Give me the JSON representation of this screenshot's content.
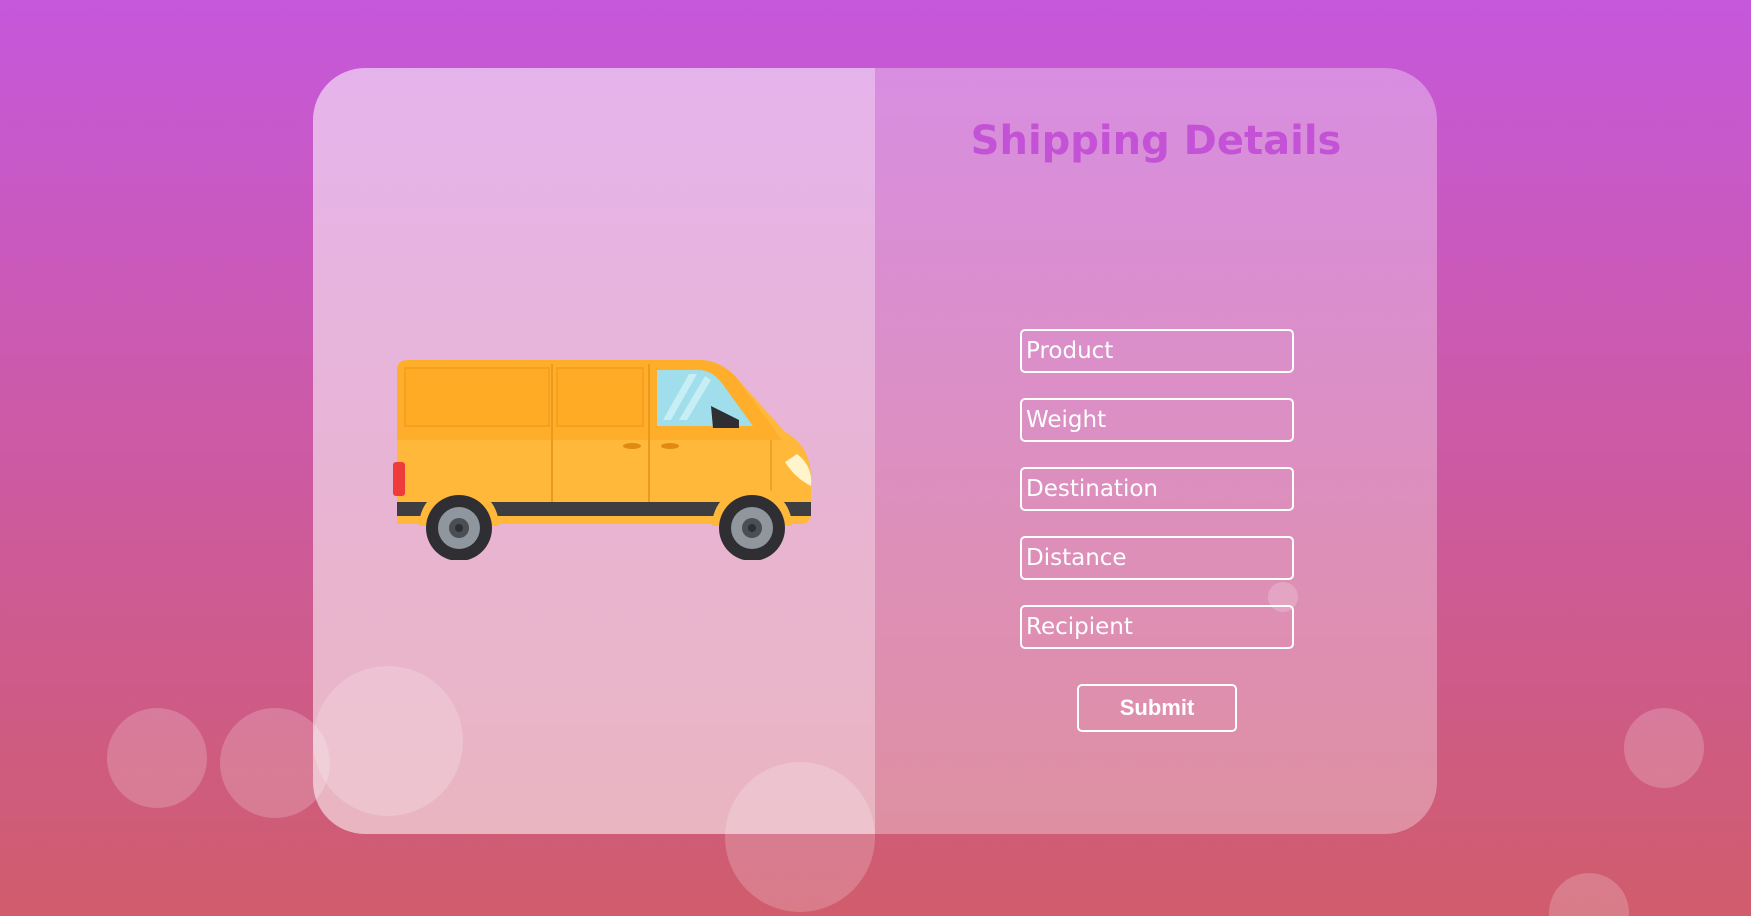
{
  "form": {
    "title": "Shipping Details",
    "fields": [
      {
        "placeholder": "Product"
      },
      {
        "placeholder": "Weight"
      },
      {
        "placeholder": "Destination"
      },
      {
        "placeholder": "Distance"
      },
      {
        "placeholder": "Recipient"
      }
    ],
    "submit_label": "Submit"
  },
  "illustration": {
    "icon": "delivery-van-icon"
  },
  "colors": {
    "background_top": "#c558dc",
    "background_bottom": "#d05c6c",
    "title": "#c452d6",
    "van_body": "#ffb83a"
  }
}
